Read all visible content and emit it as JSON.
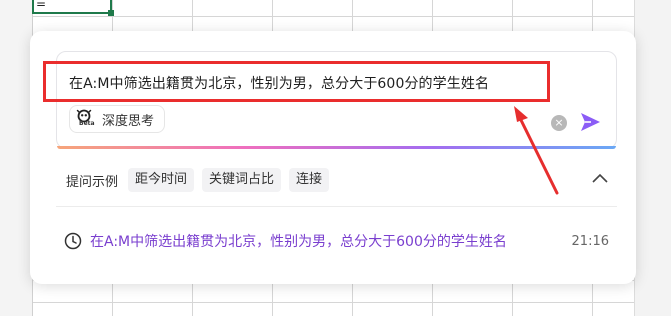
{
  "spreadsheet": {
    "active_cell_text": "="
  },
  "panel": {
    "prompt_text": "在A:M中筛选出籍贯为北京，性别为男，总分大于600分的学生姓名",
    "deep_think": {
      "label": "深度思考",
      "beta": "Beta"
    },
    "examples": {
      "label": "提问示例",
      "chips": [
        "距今时间",
        "关键词占比",
        "连接"
      ]
    },
    "history": {
      "query": "在A:M中筛选出籍贯为北京，性别为男，总分大于600分的学生姓名",
      "time": "21:16"
    }
  },
  "colors": {
    "annotation_red": "#ea2d2d",
    "send_purple": "#8b5cf6",
    "history_purple": "#7a3fcf",
    "cell_border_green": "#1f7a4b"
  },
  "icons": [
    "clear-icon",
    "send-icon",
    "collapse-icon",
    "clock-icon",
    "deep-think-icon"
  ]
}
